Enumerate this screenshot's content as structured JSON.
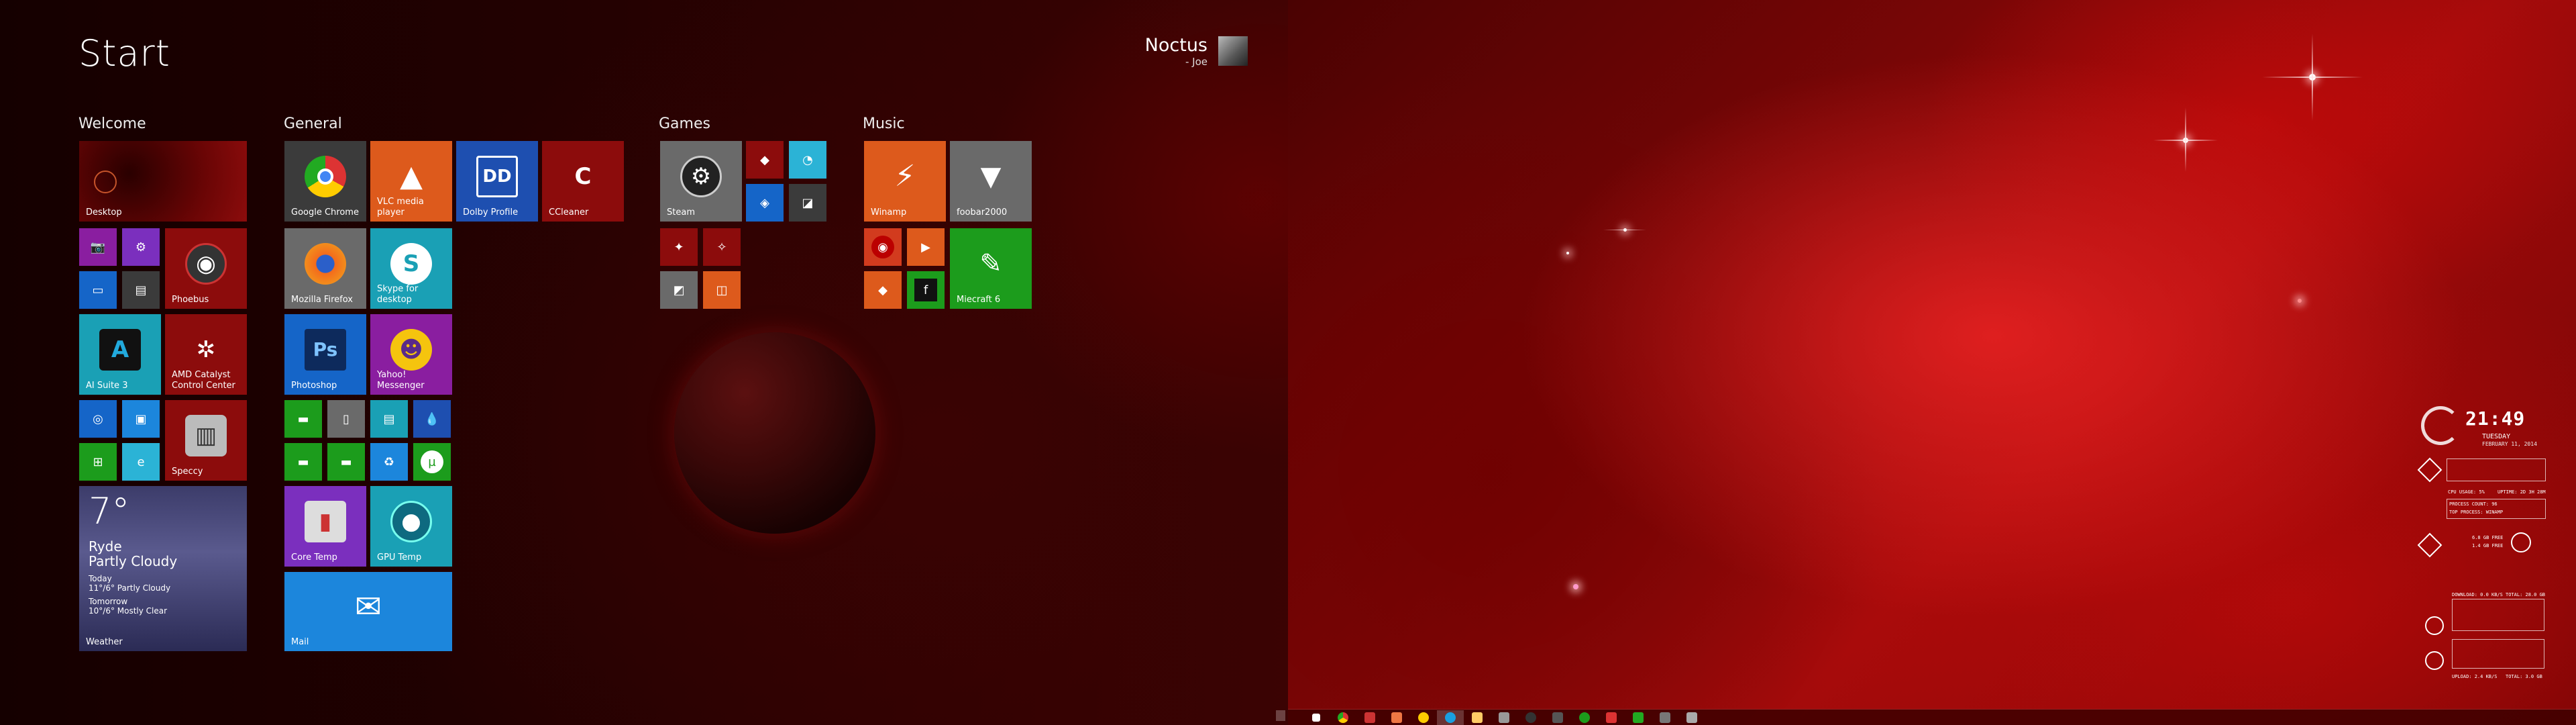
{
  "start": {
    "title": "Start",
    "user_name": "Noctus",
    "user_sub": "- Joe"
  },
  "groups": {
    "welcome": "Welcome",
    "general": "General",
    "games": "Games",
    "music": "Music"
  },
  "tiles": {
    "desktop": "Desktop",
    "phoebus": "Phoebus",
    "ai_suite": "AI Suite 3",
    "amd_1": "AMD Catalyst",
    "amd_2": "Control Center",
    "speccy": "Speccy",
    "chrome": "Google Chrome",
    "vlc_1": "VLC media",
    "vlc_2": "player",
    "dolby": "Dolby Profile",
    "ccleaner": "CCleaner",
    "firefox": "Mozilla Firefox",
    "skype_1": "Skype for",
    "skype_2": "desktop",
    "photoshop": "Photoshop",
    "yahoo_1": "Yahoo!",
    "yahoo_2": "Messenger",
    "coretemp": "Core Temp",
    "gputemp": "GPU Temp",
    "mail": "Mail",
    "steam": "Steam",
    "winamp": "Winamp",
    "foobar": "foobar2000",
    "miecraft": "Miecraft 6"
  },
  "weather": {
    "temp": "7°",
    "place": "Ryde",
    "condition": "Partly Cloudy",
    "today_label": "Today",
    "today_value": "11°/6° Partly Cloudy",
    "tomorrow_label": "Tomorrow",
    "tomorrow_value": "10°/6° Mostly Clear",
    "label": "Weather"
  },
  "rainmeter": {
    "time": "21:49",
    "day": "TUESDAY",
    "date": "FEBRUARY 11, 2014",
    "cpu_usage": "CPU USAGE: 5%",
    "uptime": "UPTIME: 2D 3H 28M",
    "process_count": "PROCESS COUNT: 96",
    "top_process": "TOP PROCESS: WINAMP",
    "ram_free": "6.8 GB FREE",
    "disk_free": "1.4 GB FREE",
    "download": "DOWNLOAD: 0.0 KB/S",
    "total_down": "TOTAL: 28.0 GB",
    "upload": "UPLOAD: 2.4 KB/S",
    "total_up": "TOTAL: 3.0 GB"
  },
  "colors": {
    "accent_red": "#8c0c0c",
    "taskbar": "#3c0000"
  }
}
